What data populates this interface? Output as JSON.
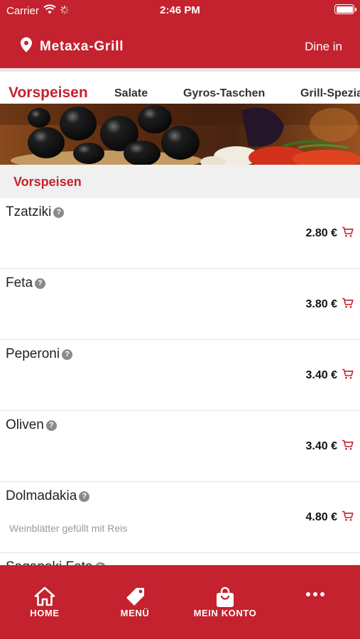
{
  "status_bar": {
    "carrier": "Carrier",
    "time": "2:46 PM"
  },
  "header": {
    "store_name": "Metaxa-Grill",
    "order_mode": "Dine in"
  },
  "tabs": [
    {
      "label": "Vorspeisen",
      "active": true
    },
    {
      "label": "Salate",
      "active": false
    },
    {
      "label": "Gyros-Taschen",
      "active": false
    },
    {
      "label": "Grill-Spezia",
      "active": false
    }
  ],
  "section": {
    "title": "Vorspeisen"
  },
  "items": [
    {
      "name": "Tzatziki",
      "price": "2.80 €",
      "description": ""
    },
    {
      "name": "Feta",
      "price": "3.80 €",
      "description": ""
    },
    {
      "name": "Peperoni",
      "price": "3.40 €",
      "description": ""
    },
    {
      "name": "Oliven",
      "price": "3.40 €",
      "description": ""
    },
    {
      "name": "Dolmadakia",
      "price": "4.80 €",
      "description": "Weinblätter gefüllt mit Reis"
    },
    {
      "name": "Saganaki Feta",
      "price": "",
      "description": ""
    }
  ],
  "info_glyph": "?",
  "bottom_nav": [
    {
      "label": "HOME",
      "icon": "home-icon"
    },
    {
      "label": "MENÜ",
      "icon": "tag-icon"
    },
    {
      "label": "MEIN KONTO",
      "icon": "shopping-bag-icon"
    },
    {
      "label": "",
      "icon": "more-icon"
    }
  ],
  "colors": {
    "brand_red": "#c4222e",
    "section_bg": "#f0f0f0",
    "muted_text": "#9a9a9a"
  }
}
